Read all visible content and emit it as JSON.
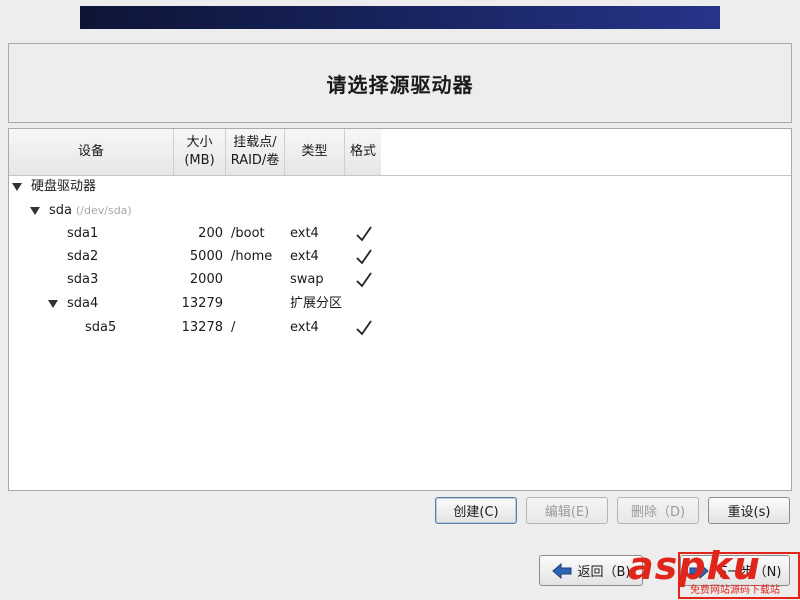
{
  "title": "请选择源驱动器",
  "columns": {
    "device": "设备",
    "size_line1": "大小",
    "size_line2": "(MB)",
    "mount_line1": "挂载点/",
    "mount_line2": "RAID/卷",
    "type": "类型",
    "format": "格式"
  },
  "tree": {
    "root_label": "硬盘驱动器",
    "disk": {
      "name": "sda",
      "path": "(/dev/sda)"
    },
    "partitions": [
      {
        "name": "sda1",
        "size": "200",
        "mount": "/boot",
        "type": "ext4",
        "formatted": true
      },
      {
        "name": "sda2",
        "size": "5000",
        "mount": "/home",
        "type": "ext4",
        "formatted": true
      },
      {
        "name": "sda3",
        "size": "2000",
        "mount": "",
        "type": "swap",
        "formatted": true
      },
      {
        "name": "sda4",
        "size": "13279",
        "mount": "",
        "type": "扩展分区",
        "formatted": false
      },
      {
        "name": "sda5",
        "size": "13278",
        "mount": "/",
        "type": "ext4",
        "formatted": true
      }
    ]
  },
  "actions": {
    "create": "创建(C)",
    "edit": "编辑(E)",
    "delete": "删除（D)",
    "reset": "重设(s)"
  },
  "nav": {
    "back": "返回（B)",
    "next": "下一步（N)"
  },
  "watermark": {
    "brand": "aspku",
    "sub": "免费网站源码下载站"
  },
  "colors": {
    "banner": "#17225a",
    "accent_border": "#5c7ea8",
    "watermark": "#e0251b"
  }
}
